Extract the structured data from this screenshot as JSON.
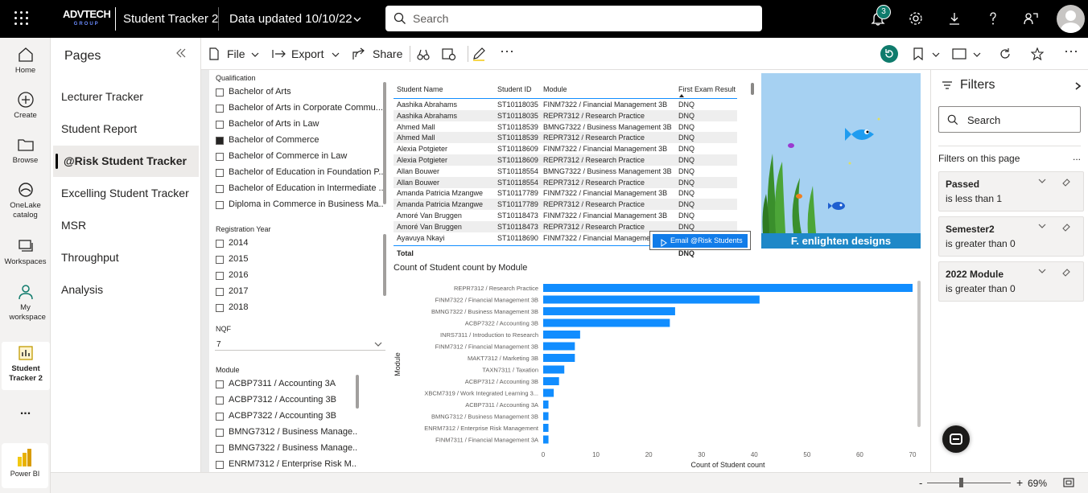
{
  "topbar": {
    "logo_main": "ADVTECH",
    "logo_sub": "GROUP",
    "app_title": "Student Tracker 2",
    "data_updated": "Data updated 10/10/22",
    "search_placeholder": "Search",
    "notification_count": "3"
  },
  "leftnav": {
    "items": [
      {
        "label": "Home"
      },
      {
        "label": "Create"
      },
      {
        "label": "Browse"
      },
      {
        "label": "OneLake catalog"
      },
      {
        "label": "Workspaces"
      },
      {
        "label": "My workspace"
      },
      {
        "label": "Student Tracker 2"
      },
      {
        "label": "..."
      }
    ],
    "brand": "Power BI"
  },
  "pages": {
    "title": "Pages",
    "items": [
      {
        "label": "Lecturer Tracker"
      },
      {
        "label": "Student Report"
      },
      {
        "label": "@Risk Student Tracker"
      },
      {
        "label": "Excelling Student Tracker"
      },
      {
        "label": "MSR"
      },
      {
        "label": "Throughput"
      },
      {
        "label": "Analysis"
      }
    ],
    "active_index": 2
  },
  "toolbar": {
    "file": "File",
    "export": "Export",
    "share": "Share"
  },
  "slicers": {
    "qualification": {
      "title": "Qualification",
      "items": [
        {
          "label": "Bachelor of Arts",
          "checked": false
        },
        {
          "label": "Bachelor of Arts in Corporate Commu...",
          "checked": false
        },
        {
          "label": "Bachelor of Arts in Law",
          "checked": false
        },
        {
          "label": "Bachelor of Commerce",
          "checked": true
        },
        {
          "label": "Bachelor of Commerce in Law",
          "checked": false
        },
        {
          "label": "Bachelor of Education in Foundation P...",
          "checked": false
        },
        {
          "label": "Bachelor of Education in Intermediate ...",
          "checked": false
        },
        {
          "label": "Diploma in Commerce in Business Ma...",
          "checked": false
        }
      ]
    },
    "registration_year": {
      "title": "Registration Year",
      "items": [
        {
          "label": "2014",
          "checked": false
        },
        {
          "label": "2015",
          "checked": false
        },
        {
          "label": "2016",
          "checked": false
        },
        {
          "label": "2017",
          "checked": false
        },
        {
          "label": "2018",
          "checked": false
        }
      ]
    },
    "nqf": {
      "title": "NQF",
      "value": "7"
    },
    "module": {
      "title": "Module",
      "items": [
        {
          "label": "ACBP7311 / Accounting 3A",
          "checked": false
        },
        {
          "label": "ACBP7312 / Accounting 3B",
          "checked": false
        },
        {
          "label": "ACBP7322 / Accounting 3B",
          "checked": false
        },
        {
          "label": "BMNG7312 / Business Manage...",
          "checked": false
        },
        {
          "label": "BMNG7322 / Business Manage...",
          "checked": false
        },
        {
          "label": "ENRM7312 / Enterprise Risk M...",
          "checked": false
        }
      ]
    }
  },
  "table": {
    "headers": [
      "Student Name",
      "Student ID",
      "Module",
      "First Exam Result"
    ],
    "rows": [
      [
        "Aashika Abrahams",
        "ST10118035",
        "FINM7322 / Financial Management 3B",
        "DNQ"
      ],
      [
        "Aashika Abrahams",
        "ST10118035",
        "REPR7312 / Research Practice",
        "DNQ"
      ],
      [
        "Ahmed Mall",
        "ST10118539",
        "BMNG7322 / Business Management 3B",
        "DNQ"
      ],
      [
        "Ahmed Mall",
        "ST10118539",
        "REPR7312 / Research Practice",
        "DNQ"
      ],
      [
        "Alexia Potgieter",
        "ST10118609",
        "FINM7322 / Financial Management 3B",
        "DNQ"
      ],
      [
        "Alexia Potgieter",
        "ST10118609",
        "REPR7312 / Research Practice",
        "DNQ"
      ],
      [
        "Allan Bouwer",
        "ST10118554",
        "BMNG7322 / Business Management 3B",
        "DNQ"
      ],
      [
        "Allan Bouwer",
        "ST10118554",
        "REPR7312 / Research Practice",
        "DNQ"
      ],
      [
        "Amanda Patricia Mzangwe",
        "ST10117789",
        "FINM7322 / Financial Management 3B",
        "DNQ"
      ],
      [
        "Amanda Patricia Mzangwe",
        "ST10117789",
        "REPR7312 / Research Practice",
        "DNQ"
      ],
      [
        "Amoré Van Bruggen",
        "ST10118473",
        "FINM7322 / Financial Management 3B",
        "DNQ"
      ],
      [
        "Amoré Van Bruggen",
        "ST10118473",
        "REPR7312 / Research Practice",
        "DNQ"
      ],
      [
        "Ayavuya Nkayi",
        "ST10118690",
        "FINM7322 / Financial Management 3B",
        "DNQ"
      ]
    ],
    "total_label": "Total",
    "total_value": "DNQ"
  },
  "image": {
    "caption": "enlighten designs"
  },
  "email_button": "Email @Risk Students",
  "chart_data": {
    "type": "bar",
    "orientation": "horizontal",
    "title": "Count of Student count by Module",
    "xlabel": "Count of Student count",
    "ylabel": "Module",
    "xlim": [
      0,
      70
    ],
    "xticks": [
      0,
      10,
      20,
      30,
      40,
      50,
      60,
      70
    ],
    "categories": [
      "REPR7312 / Research Practice",
      "FINM7322 / Financial Management 3B",
      "BMNG7322 / Business Management 3B",
      "ACBP7322 / Accounting 3B",
      "INRS7311 / Introduction to Research",
      "FINM7312 / Financial Management 3B",
      "MAKT7312 / Marketing 3B",
      "TAXN7311 / Taxation",
      "ACBP7312 / Accounting 3B",
      "XBCM7319 / Work Integrated Learning 3...",
      "ACBP7311 / Accounting 3A",
      "BMNG7312 / Business Management 3B",
      "ENRM7312 / Enterprise Risk Management",
      "FINM7311 / Financial Management 3A"
    ],
    "values": [
      70,
      41,
      25,
      24,
      7,
      6,
      6,
      4,
      3,
      2,
      1,
      1,
      1,
      1
    ],
    "bar_color": "#118DFF",
    "grid": false
  },
  "filters": {
    "title": "Filters",
    "search_placeholder": "Search",
    "section_label": "Filters on this page",
    "more": "...",
    "cards": [
      {
        "title": "Passed",
        "desc": "is less than 1"
      },
      {
        "title": "Semester2",
        "desc": "is greater than 0"
      },
      {
        "title": "2022 Module",
        "desc": "is greater than 0"
      }
    ]
  },
  "status": {
    "zoom_minus": "-",
    "zoom_plus": "+",
    "zoom_level": "69%",
    "zoom_fraction": 0.4
  }
}
